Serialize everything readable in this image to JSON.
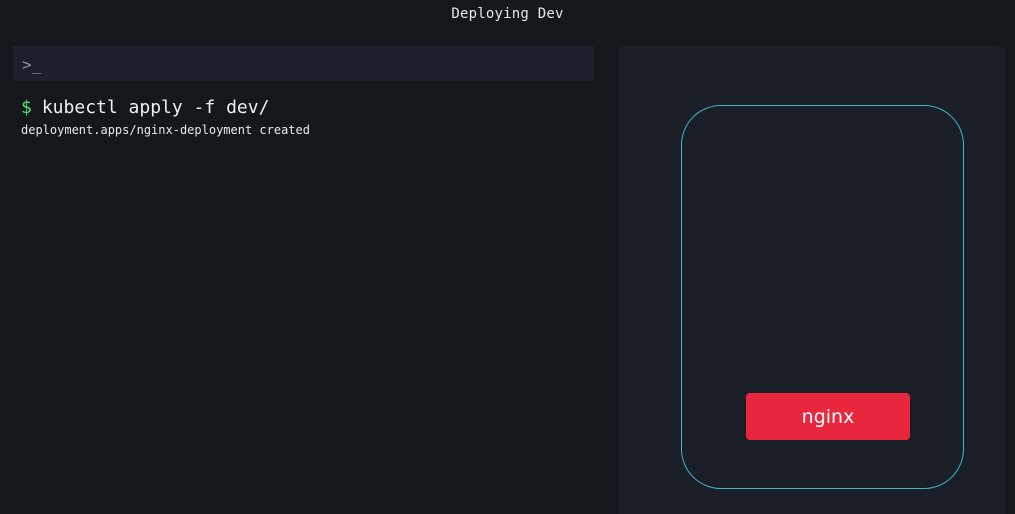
{
  "header": {
    "title": "Deploying Dev"
  },
  "terminal": {
    "prompt_icon": ">_",
    "prompt_symbol": "$",
    "command": "kubectl apply -f dev/",
    "output": "deployment.apps/nginx-deployment created"
  },
  "cluster": {
    "node_border_color": "#3fb6c8",
    "pods": [
      {
        "label": "nginx",
        "color": "#e8263d"
      }
    ]
  }
}
